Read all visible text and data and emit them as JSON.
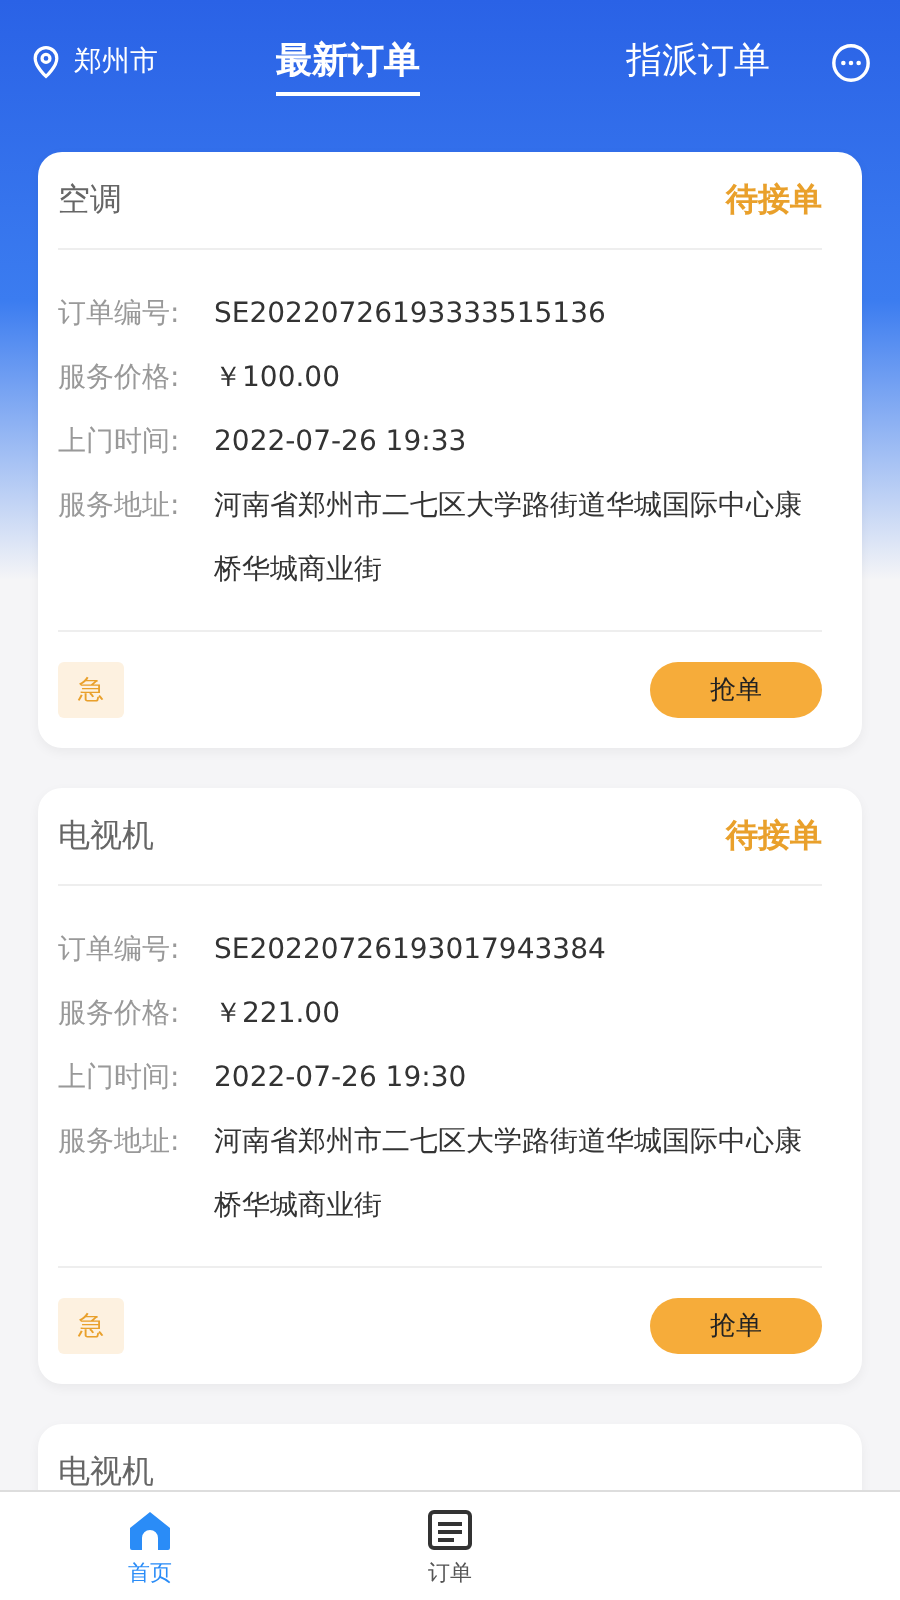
{
  "header": {
    "city": "郑州市",
    "tabs": [
      {
        "label": "最新订单",
        "selected": true
      },
      {
        "label": "指派订单",
        "selected": false
      }
    ]
  },
  "orders": [
    {
      "category": "空调",
      "status": "待接单",
      "fields": [
        {
          "label": "订单编号:",
          "value": "SE20220726193333515136"
        },
        {
          "label": "服务价格:",
          "value": "￥100.00"
        },
        {
          "label": "上门时间:",
          "value": "2022-07-26 19:33"
        },
        {
          "label": "服务地址:",
          "value": "河南省郑州市二七区大学路街道华城国际中心康桥华城商业街"
        }
      ],
      "urgent_tag": "急",
      "action": "抢单"
    },
    {
      "category": "电视机",
      "status": "待接单",
      "fields": [
        {
          "label": "订单编号:",
          "value": "SE20220726193017943384"
        },
        {
          "label": "服务价格:",
          "value": "￥221.00"
        },
        {
          "label": "上门时间:",
          "value": "2022-07-26 19:30"
        },
        {
          "label": "服务地址:",
          "value": "河南省郑州市二七区大学路街道华城国际中心康桥华城商业街"
        }
      ],
      "urgent_tag": "急",
      "action": "抢单"
    },
    {
      "category": "电视机"
    }
  ],
  "tab_bar": [
    {
      "label": "首页",
      "selected": true,
      "kind": "home"
    },
    {
      "label": "订单",
      "selected": false,
      "kind": "orders"
    }
  ]
}
